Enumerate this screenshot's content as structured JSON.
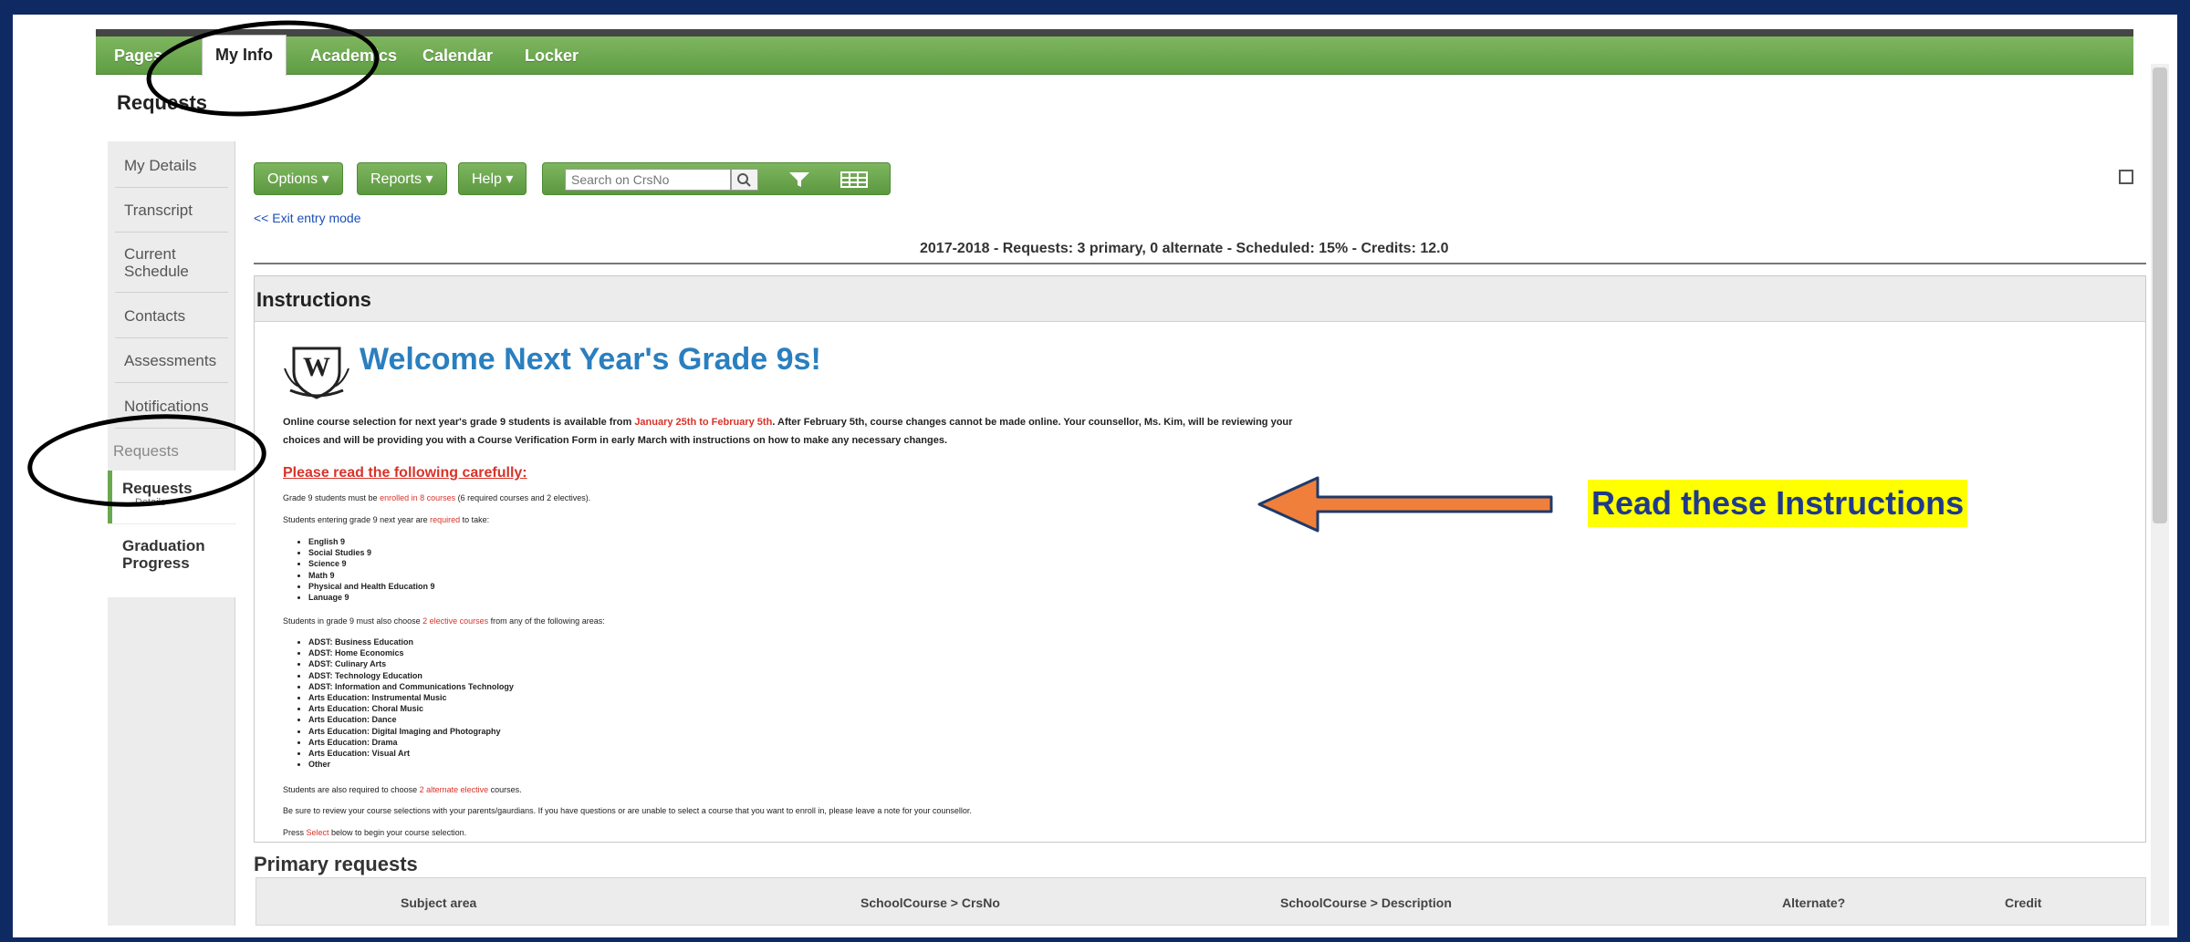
{
  "tabs": [
    "Pages",
    "My Info",
    "Academics",
    "Calendar",
    "Locker"
  ],
  "page_title": "Requests",
  "sidebar": {
    "items": [
      "My Details",
      "Transcript",
      "Current Schedule",
      "Contacts",
      "Assessments",
      "Notifications"
    ],
    "group_label": "Requests",
    "selected": {
      "label": "Requests",
      "sub": "Details"
    },
    "graduation": "Graduation Progress"
  },
  "toolbar": {
    "options": "Options",
    "reports": "Reports",
    "help": "Help",
    "search_placeholder": "Search on CrsNo"
  },
  "exit_link": "<< Exit entry mode",
  "summary": "2017-2018 - Requests: 3 primary, 0 alternate - Scheduled: 15% - Credits: 12.0",
  "instructions": {
    "title": "Instructions",
    "crest_letter": "W",
    "welcome": "Welcome Next Year's Grade 9s!",
    "intro_1a": "Online course selection for next year's grade 9 students is available from ",
    "intro_1b": "January 25th to February 5th",
    "intro_1c": ". After February 5th, course changes cannot be made online. Your counsellor, Ms. Kim, will be reviewing your",
    "intro_2": "choices and will be providing you with a Course Verification Form in early March with instructions on how to make any necessary changes.",
    "read_heading": "Please read the following carefully:",
    "enroll_a": "Grade 9 students must be ",
    "enroll_b": "enrolled in 8 courses",
    "enroll_c": " (6 required courses and 2 electives).",
    "required_a": "Students entering grade 9 next year are ",
    "required_b": "required",
    "required_c": " to take:",
    "required_courses": [
      "English 9",
      "Social Studies 9",
      "Science 9",
      "Math 9",
      "Physical and Health Education 9",
      "Lanuage 9"
    ],
    "elective_a": "Students in grade 9 must also choose ",
    "elective_b": "2 elective courses",
    "elective_c": " from any of the following areas:",
    "elective_areas": [
      "ADST: Business Education",
      "ADST: Home Economics",
      "ADST: Culinary Arts",
      "ADST: Technology Education",
      "ADST: Information and Communications Technology",
      "Arts Education: Instrumental Music",
      "Arts Education: Choral Music",
      "Arts Education: Dance",
      "Arts Education: Digital Imaging and Photography",
      "Arts Education: Drama",
      "Arts Education: Visual Art",
      "Other"
    ],
    "alt_a": "Students are also required to choose ",
    "alt_b": "2 alternate elective",
    "alt_c": " courses.",
    "review": "Be sure to review your course selections with your parents/gaurdians. If you have questions or are unable to select a course that you want to enroll in, please leave a note for your counsellor.",
    "press_a": "Press ",
    "press_b": "Select",
    "press_c": " below to begin your course selection."
  },
  "primary_requests": {
    "title": "Primary requests",
    "columns": [
      "Subject area",
      "SchoolCourse > CrsNo",
      "SchoolCourse > Description",
      "Alternate?",
      "Credit"
    ]
  },
  "annotation": {
    "callout": "Read these Instructions",
    "arrow_color": "#f07f3c",
    "highlight_color": "#ffff00"
  },
  "colors": {
    "accent_green": "#6aa84f",
    "link_blue": "#1a4fb8",
    "heading_blue": "#2a7fbf",
    "emphasis_red": "#d8332a"
  }
}
